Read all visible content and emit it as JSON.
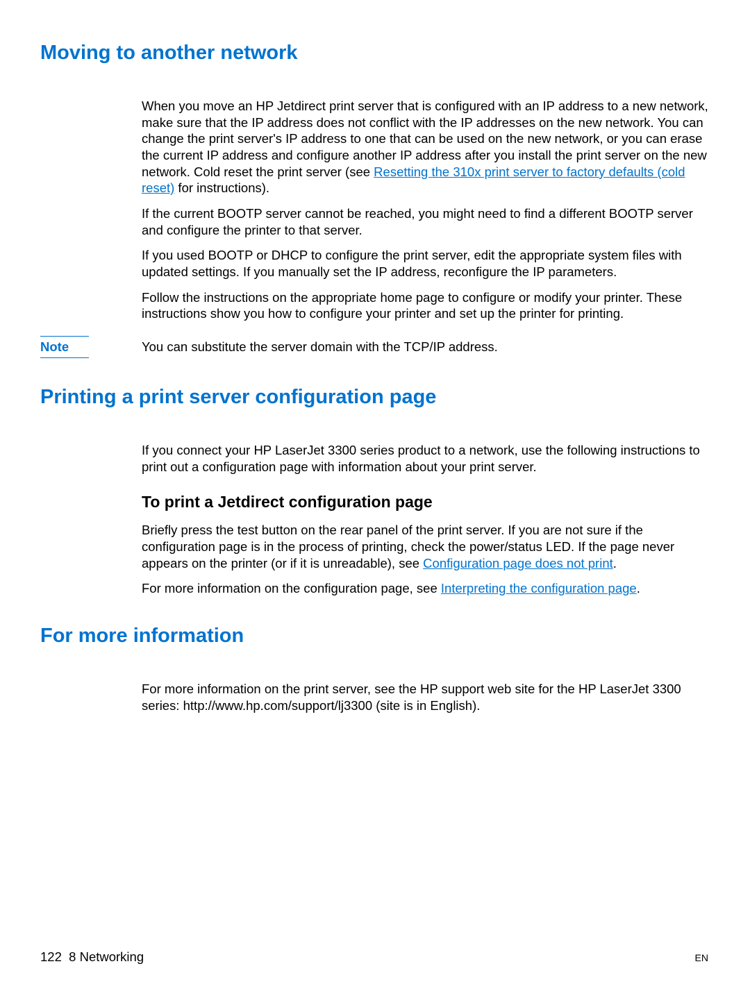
{
  "section1": {
    "heading": "Moving to another network",
    "p1_part1": "When you move an HP Jetdirect print server that is configured with an IP address to a new network, make sure that the IP address does not conflict with the IP addresses on the new network. You can change the print server's IP address to one that can be used on the new network, or you can erase the current IP address and configure another IP address after you install the print server on the new network. Cold reset the print server (see ",
    "p1_link": "Resetting the 310x print server to factory defaults (cold reset)",
    "p1_part2": " for instructions).",
    "p2": "If the current BOOTP server cannot be reached, you might need to find a different BOOTP server and configure the printer to that server.",
    "p3": "If you used BOOTP or DHCP to configure the print server, edit the appropriate system files with updated settings. If you manually set the IP address, reconfigure the IP parameters.",
    "p4": "Follow the instructions on the appropriate home page to configure or modify your printer. These instructions show you how to configure your printer and set up the printer for printing.",
    "note_label": "Note",
    "note_text": "You can substitute the server domain with the TCP/IP address."
  },
  "section2": {
    "heading": "Printing a print server configuration page",
    "p1": "If you connect your HP LaserJet 3300 series product to a network, use the following instructions to print out a configuration page with information about your print server.",
    "subheading": "To print a Jetdirect configuration page",
    "p2_part1": "Briefly press the test button on the rear panel of the print server. If you are not sure if the configuration page is in the process of printing, check the power/status LED. If the page never appears on the printer (or if it is unreadable), see ",
    "p2_link": "Configuration page does not print",
    "p2_part2": ".",
    "p3_part1": "For more information on the configuration page, see ",
    "p3_link": "Interpreting the configuration page",
    "p3_part2": "."
  },
  "section3": {
    "heading": "For more information",
    "p1": "For more information on the print server, see the HP support web site for the HP LaserJet 3300 series: http://www.hp.com/support/lj3300 (site is in English)."
  },
  "footer": {
    "page_number": "122",
    "chapter": "8 Networking",
    "lang": "EN"
  }
}
